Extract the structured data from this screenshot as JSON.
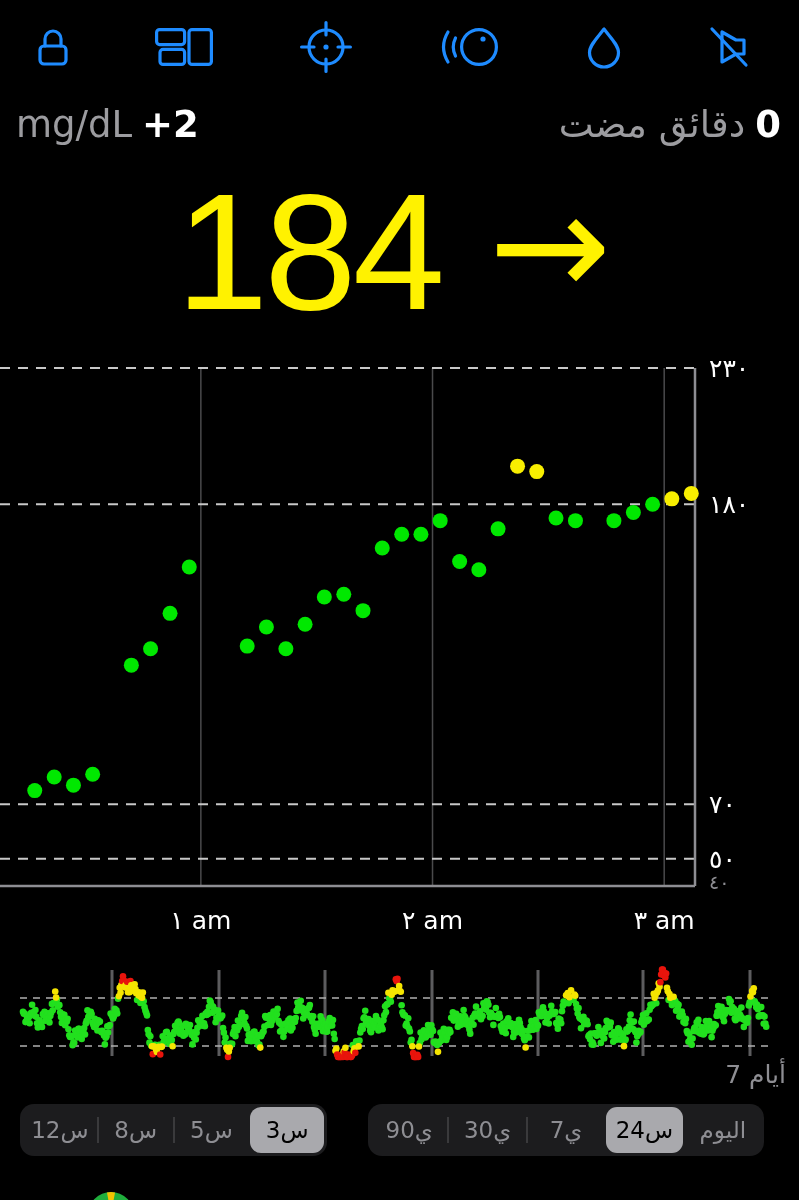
{
  "status": {
    "unit": "mg/dL",
    "delta": "+2",
    "minutes_ago": "0",
    "minutes_label": "دقائق مضت"
  },
  "reading": {
    "value": "184",
    "trend_arrow": "→"
  },
  "chart": {
    "chart_data": {
      "type": "scatter",
      "x": [
        0.283,
        0.367,
        0.45,
        0.533,
        0.7,
        0.783,
        0.867,
        0.95,
        1.2,
        1.283,
        1.367,
        1.45,
        1.533,
        1.617,
        1.7,
        1.783,
        1.867,
        1.95,
        2.033,
        2.117,
        2.2,
        2.283,
        2.367,
        2.45,
        2.533,
        2.617,
        2.783,
        2.867,
        2.95,
        3.033,
        3.117
      ],
      "series": [
        {
          "color": "#00e800",
          "values": [
            75,
            80,
            77,
            81,
            121,
            127,
            140,
            157,
            128,
            135,
            127,
            136,
            146,
            147,
            141,
            164,
            169,
            169,
            174,
            159,
            156,
            171,
            null,
            null,
            175,
            174,
            174,
            177,
            180,
            null,
            null
          ]
        },
        {
          "color": "#f8ee00",
          "values": [
            null,
            null,
            null,
            null,
            null,
            null,
            null,
            null,
            null,
            null,
            null,
            null,
            null,
            null,
            null,
            null,
            null,
            null,
            null,
            null,
            null,
            null,
            194,
            192,
            null,
            null,
            null,
            null,
            null,
            182,
            184
          ]
        }
      ],
      "xlim": [
        0.133,
        3.133
      ],
      "ylim": [
        40,
        230
      ],
      "xticks": [
        {
          "value": 1,
          "label": "١ am"
        },
        {
          "value": 2,
          "label": "٢ am"
        },
        {
          "value": 3,
          "label": "٣ am"
        }
      ],
      "yticks": [
        {
          "value": 40,
          "label": "٤٠"
        },
        {
          "value": 50,
          "label": "٥٠"
        },
        {
          "value": 70,
          "label": "٧٠"
        },
        {
          "value": 180,
          "label": "١٨٠"
        },
        {
          "value": 230,
          "label": "٢٣٠"
        }
      ],
      "grid": true
    }
  },
  "overview": {
    "label": "7 أيام"
  },
  "range_tabs": [
    {
      "label": "اليوم",
      "selected": false
    },
    {
      "label": "24س",
      "selected": true
    },
    {
      "label": "7ي",
      "selected": false
    },
    {
      "label": "30ي",
      "selected": false
    },
    {
      "label": "90ي",
      "selected": false
    }
  ],
  "hours_tabs": [
    {
      "label": "3س",
      "selected": true
    },
    {
      "label": "5س",
      "selected": false
    },
    {
      "label": "8س",
      "selected": false
    },
    {
      "label": "12س",
      "selected": false
    }
  ]
}
